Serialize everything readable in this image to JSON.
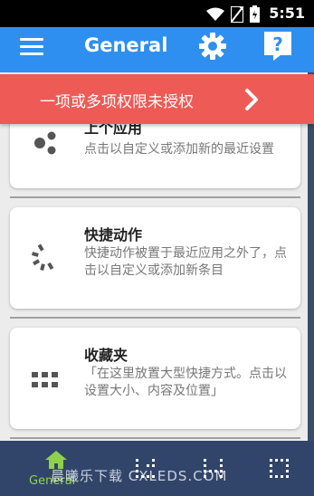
{
  "status_bar": {
    "time": "5:51",
    "icons": [
      "wifi-icon",
      "no-sim-icon",
      "battery-icon"
    ]
  },
  "app_bar": {
    "title": "General",
    "menu_icon": "hamburger-icon",
    "settings_icon": "gear-icon",
    "help_icon": "help-icon"
  },
  "banner": {
    "text": "一项或多项权限未授权",
    "icon": "chevron-right-icon"
  },
  "cards": [
    {
      "title": "上个应用",
      "description": "点击以自定义或添加新的最近设置",
      "icon": "three-dots-icon"
    },
    {
      "title": "快捷动作",
      "description": "快捷动作被置于最近应用之外了，点击以自定义或添加新条目",
      "icon": "dotted-arc-icon"
    },
    {
      "title": "收藏夹",
      "description": "「在这里放置大型快捷方式。点击以设置大小、内容及位置」",
      "icon": "grid-dots-icon"
    }
  ],
  "bottom_nav": {
    "items": [
      {
        "label": "General",
        "icon": "home-icon",
        "active": true
      },
      {
        "label": "",
        "icon": "dotted-panel-icon",
        "active": false
      },
      {
        "label": "",
        "icon": "dotted-panel-icon",
        "active": false
      },
      {
        "label": "",
        "icon": "dotted-panel-icon",
        "active": false
      }
    ],
    "watermark": "晨曦乐下载 CXLEDS.COM"
  },
  "colors": {
    "app_bar": "#2f8ff0",
    "banner": "#ee5a55",
    "bottom_nav": "#31456a",
    "active_nav": "#8fd14f"
  }
}
